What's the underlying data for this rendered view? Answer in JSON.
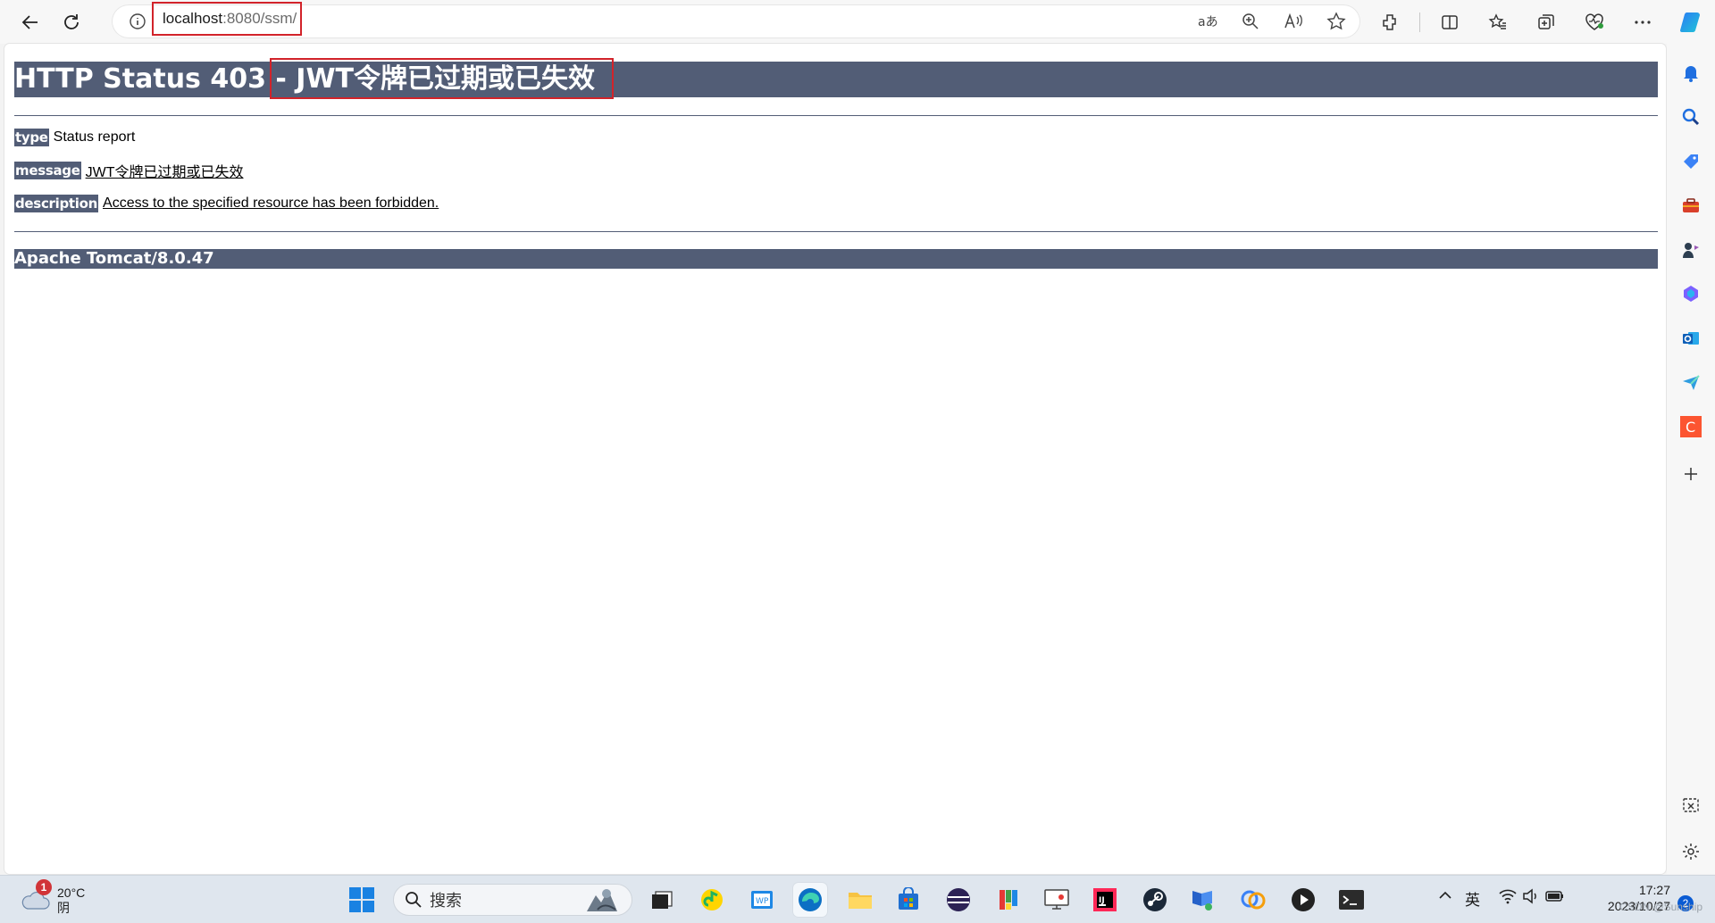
{
  "browser": {
    "url_host": "localhost",
    "url_rest": ":8080/ssm/"
  },
  "page": {
    "title": "HTTP Status 403 - JWT令牌已过期或已失效",
    "type_label": "type",
    "type_value": "Status report",
    "message_label": "message",
    "message_value": "JWT令牌已过期或已失效",
    "description_label": "description",
    "description_value": "Access to the specified resource has been forbidden.",
    "footer": "Apache Tomcat/8.0.47"
  },
  "taskbar": {
    "weather_temp": "20°C",
    "weather_desc": "阴",
    "weather_badge": "1",
    "search_placeholder": "搜索",
    "ime": "英",
    "time": "17:27",
    "date": "2023/10/27",
    "notif_count": "2",
    "watermark": "CSDN @Sunship"
  },
  "colors": {
    "accent_bar": "#525d76",
    "highlight_red": "#d2232a",
    "taskbar_bg": "#dfe6ee"
  },
  "icons": {
    "nav": [
      "back-arrow-icon",
      "refresh-icon"
    ],
    "address": [
      "site-info-icon",
      "translate-icon",
      "zoom-icon",
      "read-aloud-icon",
      "favorite-star-icon"
    ],
    "toolbar": [
      "extensions-icon",
      "split-screen-icon",
      "favorites-icon",
      "collections-icon",
      "browser-essentials-icon",
      "more-icon",
      "copilot-icon"
    ],
    "sidebar": [
      "bell-icon",
      "search-icon",
      "shopping-tag-icon",
      "tools-icon",
      "games-icon",
      "microsoft365-icon",
      "outlook-icon",
      "send-icon",
      "c-app-icon",
      "add-icon",
      "screenshot-icon",
      "settings-icon"
    ]
  }
}
